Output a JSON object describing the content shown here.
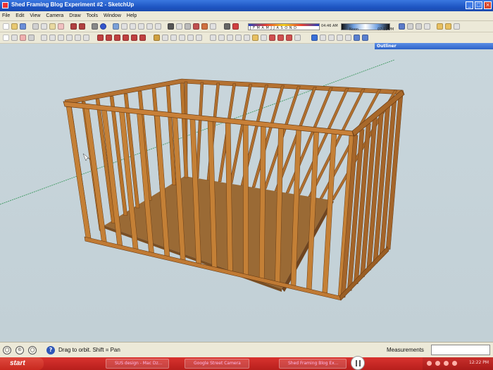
{
  "window": {
    "title": "Shed Framing Blog Experiment #2 - SketchUp",
    "buttons": [
      "_",
      "□",
      "×"
    ]
  },
  "menu": [
    "File",
    "Edit",
    "View",
    "Camera",
    "Draw",
    "Tools",
    "Window",
    "Help"
  ],
  "shadow_settings": {
    "months": "J F M A M J J A S O N D",
    "time_start": "04:46 AM",
    "time_mid": "Noon",
    "time_end": "07:12 PM"
  },
  "outliner": {
    "title": "Outliner"
  },
  "status": {
    "hint": "Drag to orbit.  Shift = Pan",
    "measurements_label": "Measurements",
    "measurements_value": ""
  },
  "taskbar": {
    "start_label": "start",
    "tasks": [
      "SUS design - Mac Dz...",
      "Google Street Camera",
      "Shed Framing Blog Ex..."
    ],
    "clock": "12:22 PM"
  },
  "colors": {
    "sky": "#c9d6dc",
    "lumber": "#b8742c",
    "floor": "#9a6a35",
    "taskbar": "#c8291f"
  }
}
